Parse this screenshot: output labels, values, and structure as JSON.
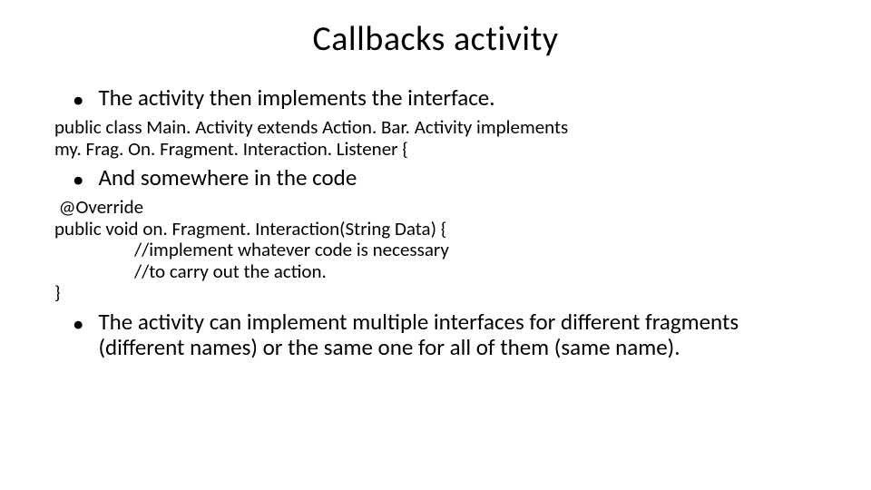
{
  "title": "Callbacks activity",
  "bullet1": "The activity then implements the interface.",
  "code1_line1": "public class Main. Activity extends Action. Bar. Activity implements",
  "code1_line2": "my. Frag. On. Fragment. Interaction. Listener {",
  "bullet2": "And somewhere in the code",
  "code2_line1": " @Override",
  "code2_line2": "public void on. Fragment. Interaction(String Data) {",
  "code2_line3": "//implement whatever code is necessary",
  "code2_line4": "//to carry out the action.",
  "code2_line5": "}",
  "bullet3": "The activity can implement multiple interfaces for different fragments (different names) or the same one for all of them (same name).",
  "dot": "•"
}
